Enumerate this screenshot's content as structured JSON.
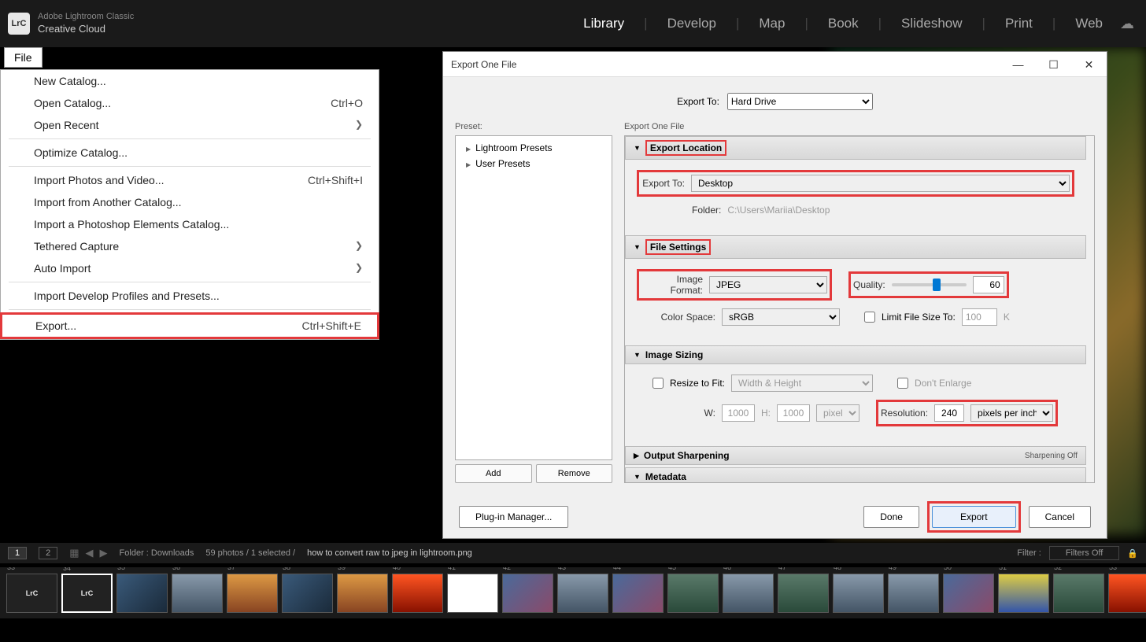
{
  "app": {
    "subtitle": "Adobe Lightroom Classic",
    "title": "Creative Cloud",
    "logo_text": "LrC"
  },
  "modules": {
    "library": "Library",
    "develop": "Develop",
    "map": "Map",
    "book": "Book",
    "slideshow": "Slideshow",
    "print": "Print",
    "web": "Web",
    "active": "Library"
  },
  "file_tab": "File",
  "file_menu": {
    "new_catalog": "New Catalog...",
    "open_catalog": "Open Catalog...",
    "open_catalog_sc": "Ctrl+O",
    "open_recent": "Open Recent",
    "optimize": "Optimize Catalog...",
    "import_photos": "Import Photos and Video...",
    "import_photos_sc": "Ctrl+Shift+I",
    "import_another": "Import from Another Catalog...",
    "import_pse": "Import a Photoshop Elements Catalog...",
    "tethered": "Tethered Capture",
    "auto_import": "Auto Import",
    "import_dev": "Import Develop Profiles and Presets...",
    "export": "Export...",
    "export_sc": "Ctrl+Shift+E"
  },
  "dialog": {
    "title": "Export One File",
    "export_to_label": "Export To:",
    "export_to_value": "Hard Drive",
    "preset_label": "Preset:",
    "settings_label": "Export One File",
    "presets": {
      "lightroom": "Lightroom Presets",
      "user": "User Presets"
    },
    "add_btn": "Add",
    "remove_btn": "Remove",
    "sections": {
      "export_location": {
        "title": "Export Location",
        "export_to_label": "Export To:",
        "export_to_value": "Desktop",
        "folder_label": "Folder:",
        "folder_value": "C:\\Users\\Mariia\\Desktop"
      },
      "file_settings": {
        "title": "File Settings",
        "format_label": "Image Format:",
        "format_value": "JPEG",
        "quality_label": "Quality:",
        "quality_value": "60",
        "colorspace_label": "Color Space:",
        "colorspace_value": "sRGB",
        "limit_label": "Limit File Size To:",
        "limit_value": "100",
        "limit_unit": "K"
      },
      "image_sizing": {
        "title": "Image Sizing",
        "resize_label": "Resize to Fit:",
        "resize_value": "Width & Height",
        "dont_enlarge": "Don't Enlarge",
        "w_label": "W:",
        "w_value": "1000",
        "h_label": "H:",
        "h_value": "1000",
        "unit_value": "pixels",
        "resolution_label": "Resolution:",
        "resolution_value": "240",
        "resolution_unit": "pixels per inch"
      },
      "sharpening": {
        "title": "Output Sharpening",
        "status": "Sharpening Off"
      },
      "metadata": {
        "title": "Metadata"
      }
    },
    "plugin_btn": "Plug-in Manager...",
    "done_btn": "Done",
    "export_btn": "Export",
    "cancel_btn": "Cancel"
  },
  "bottom_bar": {
    "view1": "1",
    "view2": "2",
    "folder_label": "Folder : Downloads",
    "count": "59 photos / 1 selected /",
    "filename": "how to convert raw to jpeg in lightroom.png",
    "filter_label": "Filter :",
    "filter_value": "Filters Off"
  },
  "filmstrip": {
    "start_num": 33,
    "items": [
      "logo",
      "logo",
      "c1",
      "c2",
      "c3",
      "c1",
      "c3",
      "c4",
      "c5",
      "c6",
      "c2",
      "c6",
      "c7",
      "c2",
      "c7",
      "c2",
      "c2",
      "c6",
      "c8",
      "c7",
      "c4"
    ]
  }
}
